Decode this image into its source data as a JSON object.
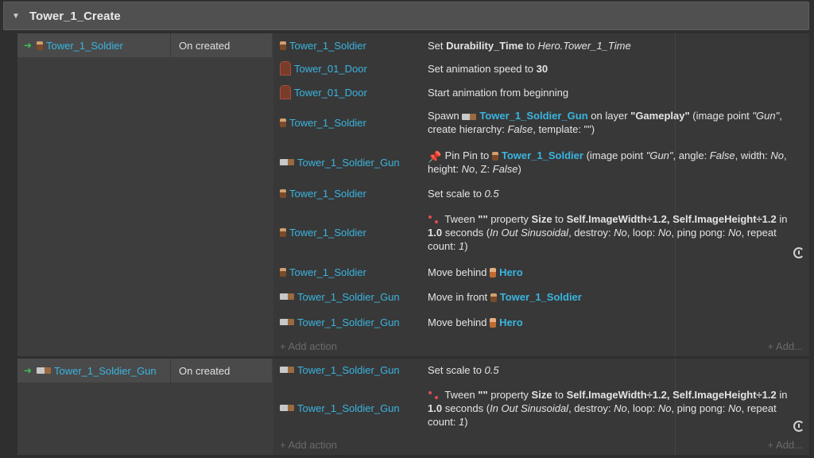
{
  "group": {
    "title": "Tower_1_Create",
    "toggle_icon": "triangle-down"
  },
  "events": [
    {
      "condition": {
        "object": "Tower_1_Soldier",
        "object_icon": "soldier",
        "trigger": "On created"
      },
      "actions": [
        {
          "object": "Tower_1_Soldier",
          "icon": "soldier",
          "text": [
            [
              "t",
              "Set "
            ],
            [
              "b",
              "Durability_Time"
            ],
            [
              "t",
              " to "
            ],
            [
              "i",
              "Hero.Tower_1_Time"
            ]
          ]
        },
        {
          "object": "Tower_01_Door",
          "icon": "door",
          "text": [
            [
              "t",
              "Set animation speed to "
            ],
            [
              "b",
              "30"
            ]
          ]
        },
        {
          "object": "Tower_01_Door",
          "icon": "door",
          "text": [
            [
              "t",
              "Start animation from beginning"
            ]
          ]
        },
        {
          "object": "Tower_1_Soldier",
          "icon": "soldier",
          "text": [
            [
              "t",
              "Spawn "
            ],
            [
              "ic",
              "gun"
            ],
            [
              "o",
              "Tower_1_Soldier_Gun"
            ],
            [
              "t",
              " on layer "
            ],
            [
              "b",
              "\"Gameplay\""
            ],
            [
              "t",
              " (image point "
            ],
            [
              "i",
              "\"Gun\""
            ],
            [
              "t",
              ", create hierarchy: "
            ],
            [
              "i",
              "False"
            ],
            [
              "t",
              ", template: \"\")"
            ]
          ]
        },
        {
          "object": "Tower_1_Soldier_Gun",
          "icon": "gun",
          "text": [
            [
              "ic",
              "pin"
            ],
            [
              "t",
              " Pin Pin to "
            ],
            [
              "ic",
              "soldier"
            ],
            [
              "o",
              "Tower_1_Soldier"
            ],
            [
              "t",
              " (image point "
            ],
            [
              "i",
              "\"Gun\""
            ],
            [
              "t",
              ", angle: "
            ],
            [
              "i",
              "False"
            ],
            [
              "t",
              ", width: "
            ],
            [
              "i",
              "No"
            ],
            [
              "t",
              ", height: "
            ],
            [
              "i",
              "No"
            ],
            [
              "t",
              ", Z: "
            ],
            [
              "i",
              "False"
            ],
            [
              "t",
              ")"
            ]
          ]
        },
        {
          "object": "Tower_1_Soldier",
          "icon": "soldier",
          "text": [
            [
              "t",
              "Set scale to "
            ],
            [
              "i",
              "0.5"
            ]
          ]
        },
        {
          "object": "Tower_1_Soldier",
          "icon": "soldier",
          "loop": true,
          "text": [
            [
              "ic",
              "tween"
            ],
            [
              "t",
              " Tween "
            ],
            [
              "b",
              "\"\""
            ],
            [
              "t",
              " property "
            ],
            [
              "b",
              "Size"
            ],
            [
              "t",
              " to "
            ],
            [
              "b",
              "Self.ImageWidth÷1.2, Self.ImageHeight÷1.2"
            ],
            [
              "t",
              " in "
            ],
            [
              "b",
              "1.0"
            ],
            [
              "t",
              "  seconds ("
            ],
            [
              "i",
              "In Out Sinusoidal"
            ],
            [
              "t",
              ", destroy: "
            ],
            [
              "i",
              "No"
            ],
            [
              "t",
              ", loop: "
            ],
            [
              "i",
              "No"
            ],
            [
              "t",
              ", ping pong: "
            ],
            [
              "i",
              "No"
            ],
            [
              "t",
              ", repeat count: "
            ],
            [
              "i",
              "1"
            ],
            [
              "t",
              ")"
            ]
          ]
        },
        {
          "object": "Tower_1_Soldier",
          "icon": "soldier",
          "text": [
            [
              "t",
              "Move behind "
            ],
            [
              "ic",
              "hero"
            ],
            [
              "o",
              "Hero"
            ]
          ]
        },
        {
          "object": "Tower_1_Soldier_Gun",
          "icon": "gun",
          "text": [
            [
              "t",
              "Move in front "
            ],
            [
              "ic",
              "soldier"
            ],
            [
              "o",
              "Tower_1_Soldier"
            ]
          ]
        },
        {
          "object": "Tower_1_Soldier_Gun",
          "icon": "gun",
          "text": [
            [
              "t",
              "Move behind "
            ],
            [
              "ic",
              "hero"
            ],
            [
              "o",
              "Hero"
            ]
          ]
        }
      ],
      "add_action": "+ Add action",
      "add_more": "+ Add..."
    },
    {
      "condition": {
        "object": "Tower_1_Soldier_Gun",
        "object_icon": "gun",
        "trigger": "On created"
      },
      "actions": [
        {
          "object": "Tower_1_Soldier_Gun",
          "icon": "gun",
          "text": [
            [
              "t",
              "Set scale to "
            ],
            [
              "i",
              "0.5"
            ]
          ]
        },
        {
          "object": "Tower_1_Soldier_Gun",
          "icon": "gun",
          "loop": true,
          "text": [
            [
              "ic",
              "tween"
            ],
            [
              "t",
              " Tween "
            ],
            [
              "b",
              "\"\""
            ],
            [
              "t",
              " property "
            ],
            [
              "b",
              "Size"
            ],
            [
              "t",
              " to "
            ],
            [
              "b",
              "Self.ImageWidth÷1.2, Self.ImageHeight÷1.2"
            ],
            [
              "t",
              " in "
            ],
            [
              "b",
              "1.0"
            ],
            [
              "t",
              "  seconds ("
            ],
            [
              "i",
              "In Out Sinusoidal"
            ],
            [
              "t",
              ", destroy: "
            ],
            [
              "i",
              "No"
            ],
            [
              "t",
              ", loop: "
            ],
            [
              "i",
              "No"
            ],
            [
              "t",
              ", ping pong: "
            ],
            [
              "i",
              "No"
            ],
            [
              "t",
              ", repeat count: "
            ],
            [
              "i",
              "1"
            ],
            [
              "t",
              ")"
            ]
          ]
        }
      ],
      "add_action": "+ Add action",
      "add_more": "+ Add..."
    }
  ]
}
